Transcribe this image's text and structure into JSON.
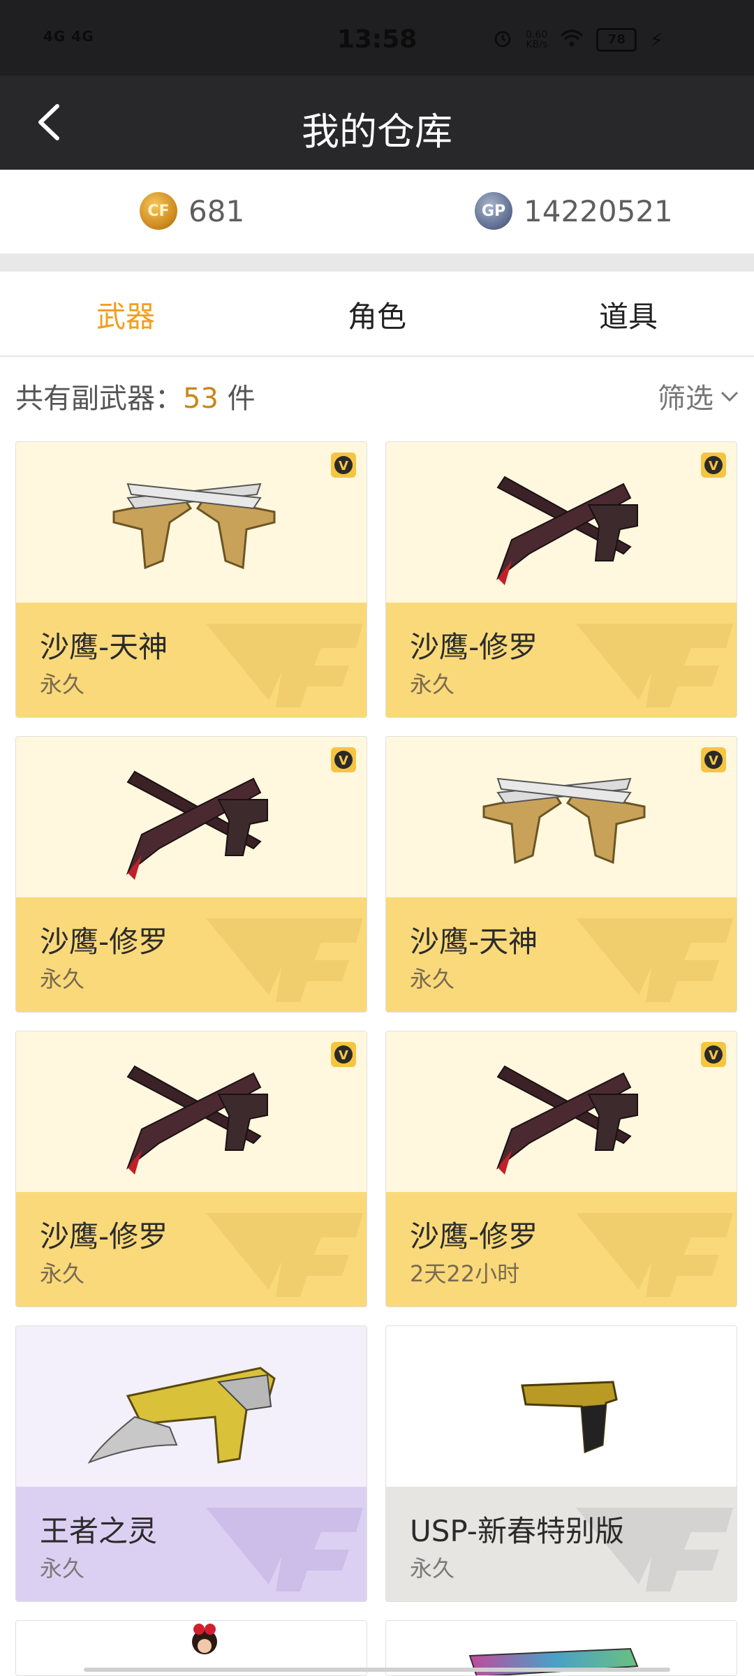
{
  "status_bar": {
    "network": "4G 4G",
    "time": "13:58",
    "speed": "0.60\nKB/s",
    "battery": "78"
  },
  "header": {
    "title": "我的仓库"
  },
  "currency": {
    "cf_points": "681",
    "gp_points": "14220521"
  },
  "tabs": [
    {
      "label": "武器",
      "active": true
    },
    {
      "label": "角色",
      "active": false
    },
    {
      "label": "道具",
      "active": false
    }
  ],
  "summary": {
    "label": "共有副武器：",
    "count": "53",
    "unit": " 件",
    "filter_label": "筛选"
  },
  "items": [
    {
      "name": "沙鹰-天神",
      "duration": "永久",
      "theme": "gold",
      "vip": true,
      "gun": "tianshen-gun-icon"
    },
    {
      "name": "沙鹰-修罗",
      "duration": "永久",
      "theme": "gold",
      "vip": true,
      "gun": "xiuluo-gun-icon"
    },
    {
      "name": "沙鹰-修罗",
      "duration": "永久",
      "theme": "gold",
      "vip": true,
      "gun": "xiuluo-gun-icon"
    },
    {
      "name": "沙鹰-天神",
      "duration": "永久",
      "theme": "gold",
      "vip": true,
      "gun": "tianshen-gun-icon"
    },
    {
      "name": "沙鹰-修罗",
      "duration": "永久",
      "theme": "gold",
      "vip": true,
      "gun": "xiuluo-gun-icon"
    },
    {
      "name": "沙鹰-修罗",
      "duration": "2天22小时",
      "theme": "gold",
      "vip": true,
      "gun": "xiuluo-gun-icon"
    },
    {
      "name": "王者之灵",
      "duration": "永久",
      "theme": "purple",
      "vip": false,
      "gun": "wangzhe-gun-icon"
    },
    {
      "name": "USP-新春特别版",
      "duration": "永久",
      "theme": "gray",
      "vip": false,
      "gun": "usp-gun-icon"
    }
  ]
}
